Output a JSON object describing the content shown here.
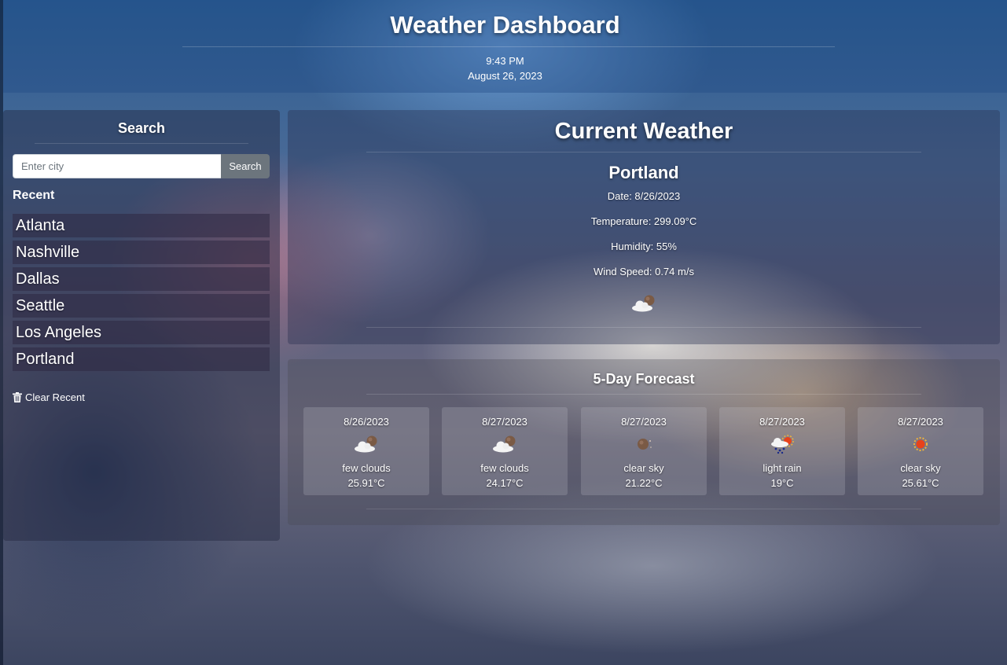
{
  "header": {
    "title": "Weather Dashboard",
    "time": "9:43 PM",
    "date": "August 26, 2023"
  },
  "search": {
    "heading": "Search",
    "placeholder": "Enter city",
    "button_label": "Search",
    "recent_label": "Recent",
    "recent_items": [
      "Atlanta",
      "Nashville",
      "Dallas",
      "Seattle",
      "Los Angeles",
      "Portland"
    ],
    "clear_label": "Clear Recent",
    "clear_icon": "trash-icon"
  },
  "current": {
    "heading": "Current Weather",
    "city": "Portland",
    "date": "Date: 8/26/2023",
    "temperature": "Temperature: 299.09°C",
    "humidity": "Humidity: 55%",
    "wind": "Wind Speed: 0.74 m/s",
    "icon": "few-clouds-night-icon"
  },
  "forecast": {
    "heading": "5-Day Forecast",
    "days": [
      {
        "date": "8/26/2023",
        "icon": "few-clouds-night-icon",
        "description": "few clouds",
        "temp": "25.91°C"
      },
      {
        "date": "8/27/2023",
        "icon": "few-clouds-night-icon",
        "description": "few clouds",
        "temp": "24.17°C"
      },
      {
        "date": "8/27/2023",
        "icon": "clear-night-icon",
        "description": "clear sky",
        "temp": "21.22°C"
      },
      {
        "date": "8/27/2023",
        "icon": "light-rain-icon",
        "description": "light rain",
        "temp": "19°C"
      },
      {
        "date": "8/27/2023",
        "icon": "clear-day-icon",
        "description": "clear sky",
        "temp": "25.61°C"
      }
    ]
  },
  "colors": {
    "button_bg": "#6c757d",
    "sun": "#e8421a",
    "moon": "#7a5a45",
    "rain": "#1a2a8a"
  }
}
